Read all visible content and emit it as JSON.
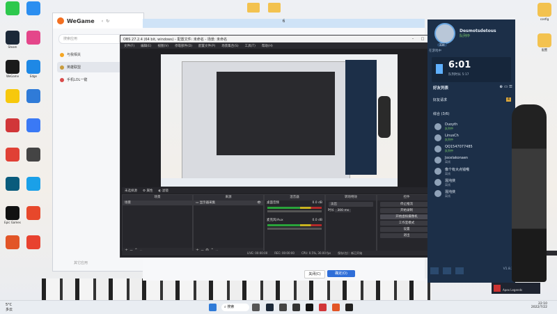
{
  "desktop_left": [
    {
      "id": "wechat",
      "label": "",
      "color": "#2dc84d"
    },
    {
      "id": "qq",
      "label": "",
      "color": "#2b8ef0"
    },
    {
      "id": "steam",
      "label": "Steam",
      "color": "#1b2838"
    },
    {
      "id": "app2",
      "label": "",
      "color": "#e4468a"
    },
    {
      "id": "wegame",
      "label": "WeGame",
      "color": "#1a1a1a"
    },
    {
      "id": "edge",
      "label": "Edge",
      "color": "#1e88e5"
    },
    {
      "id": "qqgame",
      "label": "",
      "color": "#f7c80c"
    },
    {
      "id": "easy",
      "label": "",
      "color": "#2f7bd8"
    },
    {
      "id": "riot",
      "label": "",
      "color": "#d13639"
    },
    {
      "id": "feishu",
      "label": "",
      "color": "#3a79f5"
    },
    {
      "id": "app3",
      "label": "",
      "color": "#e04035"
    },
    {
      "id": "app4",
      "label": "",
      "color": "#444444"
    },
    {
      "id": "lol",
      "label": "",
      "color": "#0a5b7c"
    },
    {
      "id": "app5",
      "label": "",
      "color": "#1aa0e8"
    },
    {
      "id": "epic",
      "label": "Epic Games",
      "color": "#111111"
    },
    {
      "id": "app6",
      "label": "",
      "color": "#e7482b"
    },
    {
      "id": "app7",
      "label": "",
      "color": "#e25527"
    },
    {
      "id": "app8",
      "label": "",
      "color": "#e8422f"
    }
  ],
  "desktop_right": [
    {
      "id": "folder1",
      "label": "config"
    },
    {
      "id": "folder2",
      "label": "配置"
    }
  ],
  "wegame": {
    "title": "WeGame",
    "search_placeholder": "搜索应用",
    "nav": [
      "与我相关",
      "英雄联盟",
      "手机LOL一键"
    ],
    "footer": "其它应用"
  },
  "dialog_tab_label": "6",
  "obs": {
    "title": "OBS 27.2.4 (64 bit, windows) - 配置文件: 未命名 - 场景: 未命名",
    "menu": [
      "文件(F)",
      "编辑(E)",
      "视图(V)",
      "停靠部件(D)",
      "配置文件(P)",
      "场景集合(S)",
      "工具(T)",
      "帮助(H)"
    ],
    "no_source_label": "未选择源",
    "props_btn": "属性",
    "filters_btn": "滤镜",
    "scenes": {
      "header": "场景",
      "items": [
        "场景"
      ]
    },
    "sources": {
      "header": "来源",
      "items": [
        "显示器采集"
      ]
    },
    "mixer": {
      "header": "混音器",
      "channels": [
        {
          "name": "桌面音频",
          "db": "0.0 dB"
        },
        {
          "name": "麦克风/Aux",
          "db": "0.0 dB"
        }
      ]
    },
    "transitions": {
      "header": "转场特效",
      "type": "淡出",
      "duration_label": "时长",
      "duration": "300 ms"
    },
    "controls": {
      "header": "控件",
      "buttons": [
        "停止推流",
        "开始录制",
        "开始虚拟摄像机",
        "工作室模式",
        "设置",
        "退出"
      ]
    },
    "status": [
      "LIVE: 00:00:00",
      "REC: 00:00:00",
      "CPU: 0.5%, 30.00 fps",
      "保存(在)：新已开始"
    ]
  },
  "bottom_buttons": {
    "cancel": "关闭(C)",
    "ok": "确定(O)"
  },
  "friends": {
    "username": "Desmotsdetous",
    "status": "队列中",
    "level": "334",
    "time": "6:01",
    "time_label": "队列时长",
    "sub_time": "5:17",
    "pending_label": "在游戏中",
    "title": "好友列表",
    "requests_label": "好友请求",
    "requests_count": "4",
    "group": "综合 (3/6)",
    "list": [
      {
        "name": "Duoyth",
        "status": "队列中",
        "online": true
      },
      {
        "name": "LinusCh",
        "status": "队列中",
        "online": true
      },
      {
        "name": "QQ1547077485",
        "status": "队列中",
        "online": true
      },
      {
        "name": "Jocelakonaen",
        "status": "离线",
        "online": false
      },
      {
        "name": "像个有大点钱哦",
        "status": "离线",
        "online": false
      },
      {
        "name": "混沌侠",
        "status": "离线",
        "online": false
      },
      {
        "name": "混沌侠",
        "status": "离线",
        "online": false
      }
    ],
    "footer_version": "V1.8.28"
  },
  "notification": {
    "text": "Apex Legends"
  },
  "taskbar": {
    "weather": "5°C",
    "weather_desc": "多云",
    "search_label": "搜索",
    "time": "22:10",
    "date": "2022/7/22"
  }
}
